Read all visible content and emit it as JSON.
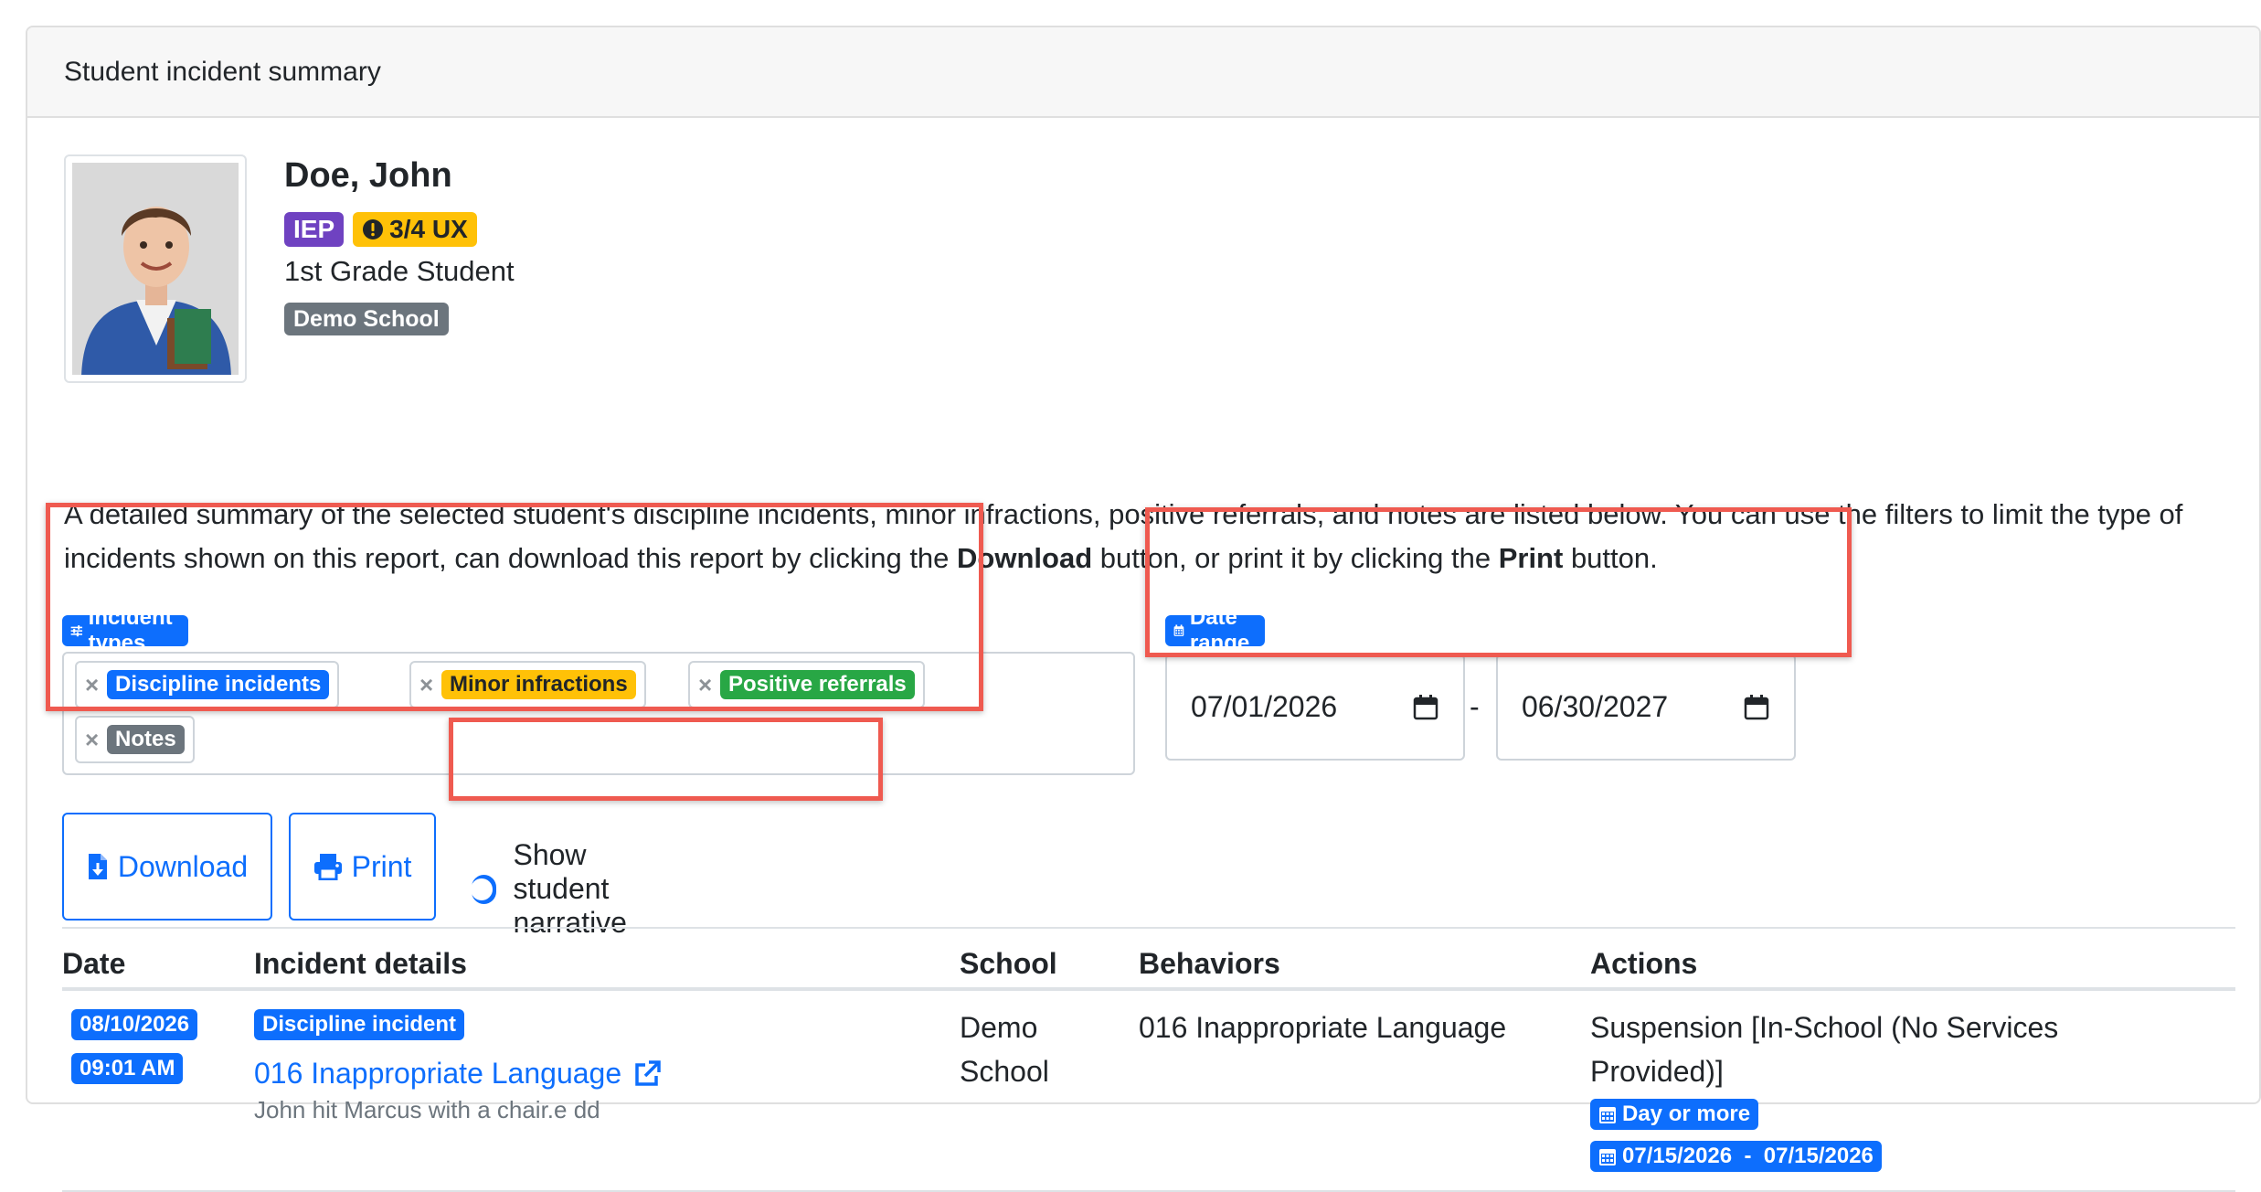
{
  "card": {
    "title": "Student incident summary"
  },
  "student": {
    "name": "Doe, John",
    "badges": [
      {
        "label": "IEP",
        "color": "#6f42c1"
      },
      {
        "label": "3/4 UX",
        "icon": "exclamation-circle-icon",
        "color": "#ffc107"
      }
    ],
    "grade": "1st Grade Student",
    "school": "Demo School"
  },
  "description": {
    "part1": "A detailed summary of the selected student's discipline incidents, minor infractions, positive referrals, and notes are listed below. You can use the filters to limit the type of incidents shown on this report, can download this report by clicking the ",
    "download_word": "Download",
    "part2": " button, or print it by clicking the ",
    "print_word": "Print",
    "part3": " button."
  },
  "filters": {
    "types_label": "Incident types",
    "types_icon": "sliders-icon",
    "types": [
      {
        "label": "Discipline incidents",
        "color": "#0d6efd"
      },
      {
        "label": "Minor infractions",
        "color": "#ffc107"
      },
      {
        "label": "Positive referrals",
        "color": "#28a745"
      },
      {
        "label": "Notes",
        "color": "#6c757d"
      }
    ],
    "date_label": "Date range",
    "date_icon": "calendar-icon",
    "date_from": "07/01/2026",
    "date_to": "06/30/2027",
    "date_separator": "-"
  },
  "actions": {
    "download_label": "Download",
    "download_icon": "file-download-icon",
    "print_label": "Print",
    "print_icon": "printer-icon",
    "narrative_label": "Show student narrative",
    "narrative_on": true
  },
  "table": {
    "headers": [
      "Date",
      "Incident details",
      "School",
      "Behaviors",
      "Actions"
    ],
    "rows": [
      {
        "date": "08/10/2026",
        "time": "09:01 AM",
        "type_badge": "Discipline incident",
        "title": "016 Inappropriate Language",
        "note": "John hit Marcus with a chair.e dd",
        "school_line1": "Demo",
        "school_line2": "School",
        "behaviors": "016 Inappropriate Language",
        "action_line1": "Suspension [In-School (No Services",
        "action_line2": "Provided)]",
        "action_badge1": "Day or more",
        "action_badge2": "07/15/2026  -  07/15/2026"
      }
    ]
  },
  "colors": {
    "primary": "#0d6efd",
    "highlight": "#ef5a50"
  }
}
